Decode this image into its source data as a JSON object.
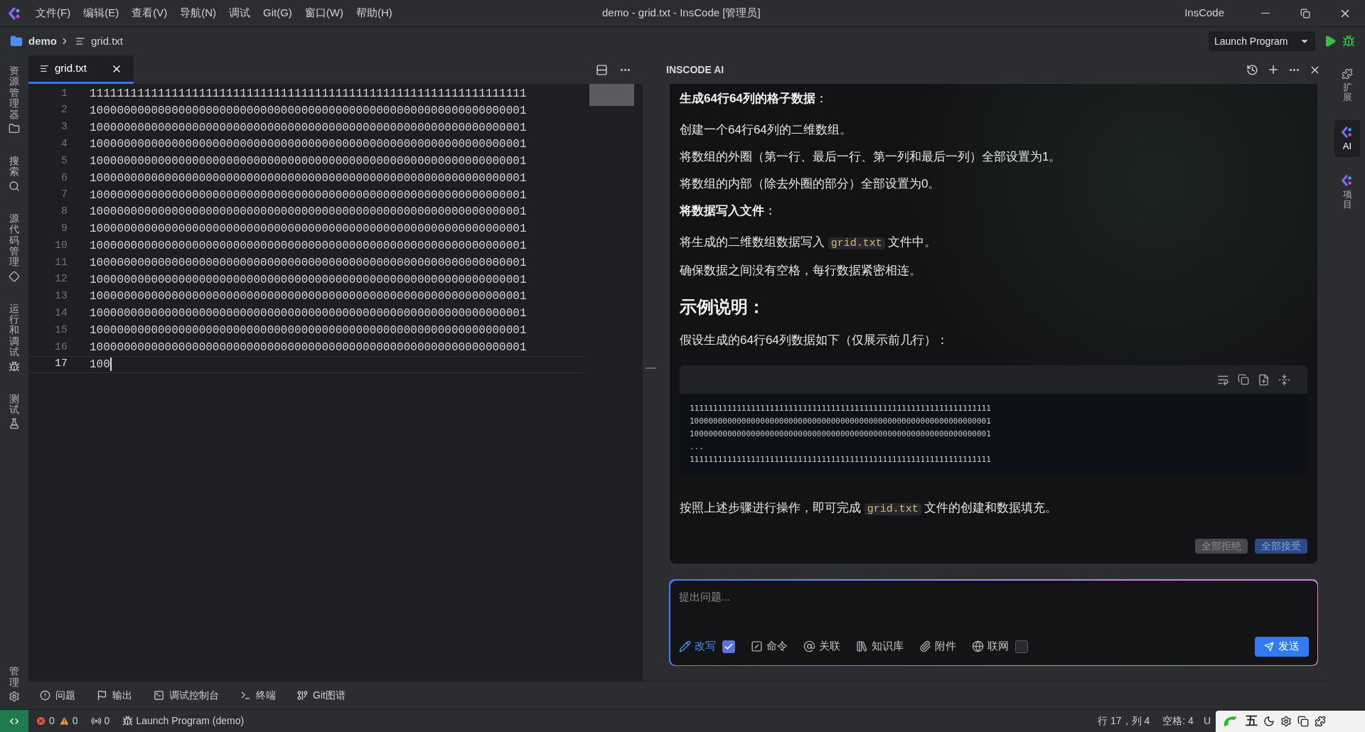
{
  "title_bar": {
    "menu": [
      "文件(F)",
      "编辑(E)",
      "查看(V)",
      "导航(N)",
      "调试",
      "Git(G)",
      "窗口(W)",
      "帮助(H)"
    ],
    "title": "demo - grid.txt - InsCode [管理员]",
    "app_name": "InsCode"
  },
  "breadcrumb": {
    "folder": "demo",
    "file": "grid.txt"
  },
  "toolbar": {
    "launch_config": "Launch Program"
  },
  "activity_bar": [
    {
      "label": "资源管理器",
      "kind": "folder"
    },
    {
      "label": "搜索",
      "kind": "search"
    },
    {
      "label": "源代码管理",
      "kind": "git"
    },
    {
      "label": "运行和调试",
      "kind": "bug"
    },
    {
      "label": "测试",
      "kind": "flask"
    },
    {
      "label": "管理",
      "kind": "gear"
    }
  ],
  "editor": {
    "tab": {
      "label": "grid.txt",
      "selected": true
    },
    "lines": [
      {
        "number": "1",
        "text": "1111111111111111111111111111111111111111111111111111111111111111",
        "current": false
      },
      {
        "number": "2",
        "text": "1000000000000000000000000000000000000000000000000000000000000001",
        "current": false
      },
      {
        "number": "3",
        "text": "1000000000000000000000000000000000000000000000000000000000000001",
        "current": false
      },
      {
        "number": "4",
        "text": "1000000000000000000000000000000000000000000000000000000000000001",
        "current": false
      },
      {
        "number": "5",
        "text": "1000000000000000000000000000000000000000000000000000000000000001",
        "current": false
      },
      {
        "number": "6",
        "text": "1000000000000000000000000000000000000000000000000000000000000001",
        "current": false
      },
      {
        "number": "7",
        "text": "1000000000000000000000000000000000000000000000000000000000000001",
        "current": false
      },
      {
        "number": "8",
        "text": "1000000000000000000000000000000000000000000000000000000000000001",
        "current": false
      },
      {
        "number": "9",
        "text": "1000000000000000000000000000000000000000000000000000000000000001",
        "current": false
      },
      {
        "number": "10",
        "text": "1000000000000000000000000000000000000000000000000000000000000001",
        "current": false
      },
      {
        "number": "11",
        "text": "1000000000000000000000000000000000000000000000000000000000000001",
        "current": false
      },
      {
        "number": "12",
        "text": "1000000000000000000000000000000000000000000000000000000000000001",
        "current": false
      },
      {
        "number": "13",
        "text": "1000000000000000000000000000000000000000000000000000000000000001",
        "current": false
      },
      {
        "number": "14",
        "text": "1000000000000000000000000000000000000000000000000000000000000001",
        "current": false
      },
      {
        "number": "15",
        "text": "1000000000000000000000000000000000000000000000000000000000000001",
        "current": false
      },
      {
        "number": "16",
        "text": "1000000000000000000000000000000000000000000000000000000000000001",
        "current": false
      },
      {
        "number": "17",
        "text": "100",
        "current": true
      }
    ]
  },
  "ai_panel": {
    "title": "INSCODE AI",
    "blocks": [
      {
        "kind": "label",
        "text": "**生成64行64列的格子数据**："
      },
      {
        "kind": "para",
        "parts": [
          {
            "text": "创建一个64行64列的二维数组。",
            "code": false
          }
        ]
      },
      {
        "kind": "para",
        "parts": [
          {
            "text": "将数组的外圈（第一行、最后一行、第一列和最后一列）全部设置为1。",
            "code": false
          }
        ]
      },
      {
        "kind": "para",
        "parts": [
          {
            "text": "将数组的内部（除去外圈的部分）全部设置为0。",
            "code": false
          }
        ]
      },
      {
        "kind": "label",
        "text": "**将数据写入文件**："
      },
      {
        "kind": "para",
        "parts": [
          {
            "text": "将生成的二维数组数据写入 ",
            "code": false
          },
          {
            "text": "grid.txt",
            "code": true
          },
          {
            "text": " 文件中。",
            "code": false
          }
        ]
      },
      {
        "kind": "para",
        "parts": [
          {
            "text": "确保数据之间没有空格，每行数据紧密相连。",
            "code": false
          }
        ]
      },
      {
        "kind": "heading",
        "text": "示例说明："
      },
      {
        "kind": "para",
        "parts": [
          {
            "text": "假设生成的64行64列数据如下（仅展示前几行）：",
            "code": false
          }
        ]
      },
      {
        "kind": "code",
        "lines": [
          "1111111111111111111111111111111111111111111111111111111111111111",
          "1000000000000000000000000000000000000000000000000000000000000001",
          "1000000000000000000000000000000000000000000000000000000000000001",
          "...",
          "1111111111111111111111111111111111111111111111111111111111111111"
        ]
      },
      {
        "kind": "para",
        "parts": [
          {
            "text": "按照上述步骤进行操作，即可完成 ",
            "code": false
          },
          {
            "text": "grid.txt",
            "code": true
          },
          {
            "text": " 文件的创建和数据填充。",
            "code": false
          }
        ]
      }
    ],
    "actions": [
      {
        "label": "全部拒绝",
        "kind": "reject"
      },
      {
        "label": "全部接受",
        "kind": "accept"
      }
    ],
    "input": {
      "placeholder": "提出问题...",
      "options": [
        {
          "label": "改写",
          "kind": "pencil",
          "checked": true
        },
        {
          "label": "命令",
          "kind": "slash"
        },
        {
          "label": "关联",
          "kind": "at"
        },
        {
          "label": "知识库",
          "kind": "library"
        },
        {
          "label": "附件",
          "kind": "clip"
        },
        {
          "label": "联网",
          "kind": "globe",
          "checked": false
        }
      ],
      "send": "发送"
    }
  },
  "right_bar": [
    {
      "label": "扩展",
      "kind": "puzzle",
      "selected": false
    },
    {
      "label": "AI",
      "kind": "logo",
      "selected": true
    },
    {
      "label": "项目",
      "kind": "logo",
      "selected": false
    }
  ],
  "panel_tabs": [
    {
      "label": "问题",
      "kind": "alert"
    },
    {
      "label": "输出",
      "kind": "flag"
    },
    {
      "label": "调试控制台",
      "kind": "console"
    },
    {
      "label": "终端",
      "kind": "terminal"
    },
    {
      "label": "Git图谱",
      "kind": "graph"
    }
  ],
  "status_bar": {
    "errors": "0",
    "warnings": "0",
    "ports": "0",
    "launch": "Launch Program (demo)",
    "position": "行 17，列 4",
    "indent": "空格: 4",
    "encoding": "U",
    "ime": "五"
  }
}
